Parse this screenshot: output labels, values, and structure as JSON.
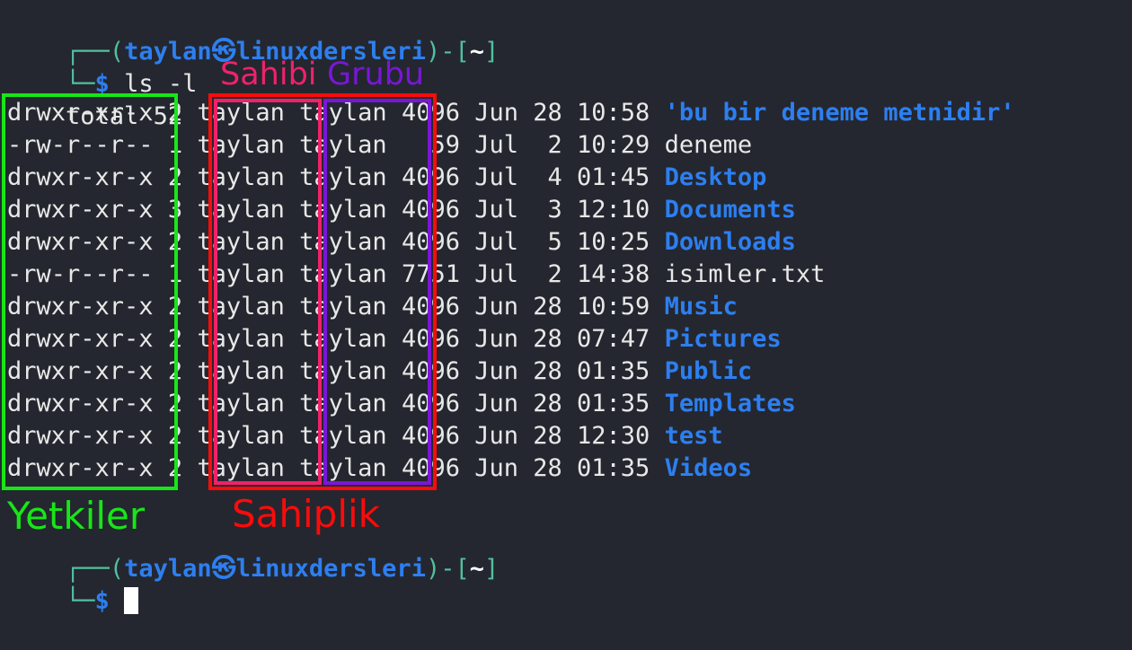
{
  "terminal": {
    "background_color": "#24272f",
    "foreground_color": "#e8e8e8",
    "prompt": {
      "frame_top": "┌──",
      "frame_bottom": "└─",
      "open_paren": "(",
      "user": "taylan",
      "logo_glyph": "㉿",
      "host": "linuxdersleri",
      "close_paren": ")",
      "dash": "-",
      "open_bracket": "[",
      "path": "~",
      "close_bracket": "]",
      "dollar": "$"
    },
    "command": "ls -l",
    "total_line": "total 52",
    "columns": {
      "perms": "Yetkiler",
      "links": "",
      "owner": "Sahibi",
      "group": "Grubu",
      "size": "",
      "date": "",
      "name": ""
    },
    "rows": [
      {
        "perms": "drwxr-xr-x",
        "links": "2",
        "owner": "taylan",
        "group": "taylan",
        "size": "4096",
        "month": "Jun",
        "day": "28",
        "time": "10:58",
        "name": "'bu bir deneme metnidir'",
        "kind": "dir"
      },
      {
        "perms": "-rw-r--r--",
        "links": "1",
        "owner": "taylan",
        "group": "taylan",
        "size": "59",
        "month": "Jul",
        "day": "2",
        "time": "10:29",
        "name": "deneme",
        "kind": "file"
      },
      {
        "perms": "drwxr-xr-x",
        "links": "2",
        "owner": "taylan",
        "group": "taylan",
        "size": "4096",
        "month": "Jul",
        "day": "4",
        "time": "01:45",
        "name": "Desktop",
        "kind": "dir"
      },
      {
        "perms": "drwxr-xr-x",
        "links": "3",
        "owner": "taylan",
        "group": "taylan",
        "size": "4096",
        "month": "Jul",
        "day": "3",
        "time": "12:10",
        "name": "Documents",
        "kind": "dir"
      },
      {
        "perms": "drwxr-xr-x",
        "links": "2",
        "owner": "taylan",
        "group": "taylan",
        "size": "4096",
        "month": "Jul",
        "day": "5",
        "time": "10:25",
        "name": "Downloads",
        "kind": "dir"
      },
      {
        "perms": "-rw-r--r--",
        "links": "1",
        "owner": "taylan",
        "group": "taylan",
        "size": "7751",
        "month": "Jul",
        "day": "2",
        "time": "14:38",
        "name": "isimler.txt",
        "kind": "file"
      },
      {
        "perms": "drwxr-xr-x",
        "links": "2",
        "owner": "taylan",
        "group": "taylan",
        "size": "4096",
        "month": "Jun",
        "day": "28",
        "time": "10:59",
        "name": "Music",
        "kind": "dir"
      },
      {
        "perms": "drwxr-xr-x",
        "links": "2",
        "owner": "taylan",
        "group": "taylan",
        "size": "4096",
        "month": "Jun",
        "day": "28",
        "time": "07:47",
        "name": "Pictures",
        "kind": "dir"
      },
      {
        "perms": "drwxr-xr-x",
        "links": "2",
        "owner": "taylan",
        "group": "taylan",
        "size": "4096",
        "month": "Jun",
        "day": "28",
        "time": "01:35",
        "name": "Public",
        "kind": "dir"
      },
      {
        "perms": "drwxr-xr-x",
        "links": "2",
        "owner": "taylan",
        "group": "taylan",
        "size": "4096",
        "month": "Jun",
        "day": "28",
        "time": "01:35",
        "name": "Templates",
        "kind": "dir"
      },
      {
        "perms": "drwxr-xr-x",
        "links": "2",
        "owner": "taylan",
        "group": "taylan",
        "size": "4096",
        "month": "Jun",
        "day": "28",
        "time": "12:30",
        "name": "test",
        "kind": "dir"
      },
      {
        "perms": "drwxr-xr-x",
        "links": "2",
        "owner": "taylan",
        "group": "taylan",
        "size": "4096",
        "month": "Jun",
        "day": "28",
        "time": "01:35",
        "name": "Videos",
        "kind": "dir"
      }
    ]
  },
  "annotations": {
    "labels": [
      {
        "id": "sahibi",
        "text": "Sahibi",
        "color": "#f0216b"
      },
      {
        "id": "grubu",
        "text": "Grubu",
        "color": "#7a16d8"
      },
      {
        "id": "yetkiler",
        "text": "Yetkiler",
        "color": "#17e617"
      },
      {
        "id": "sahiplik",
        "text": "Sahiplik",
        "color": "#fb0b0b"
      }
    ],
    "boxes": [
      {
        "id": "perms-box",
        "color": "#17e617"
      },
      {
        "id": "ownership-box",
        "color": "#fb0b0b"
      },
      {
        "id": "owner-box",
        "color": "#f0216b"
      },
      {
        "id": "group-box",
        "color": "#7a16d8"
      }
    ]
  }
}
